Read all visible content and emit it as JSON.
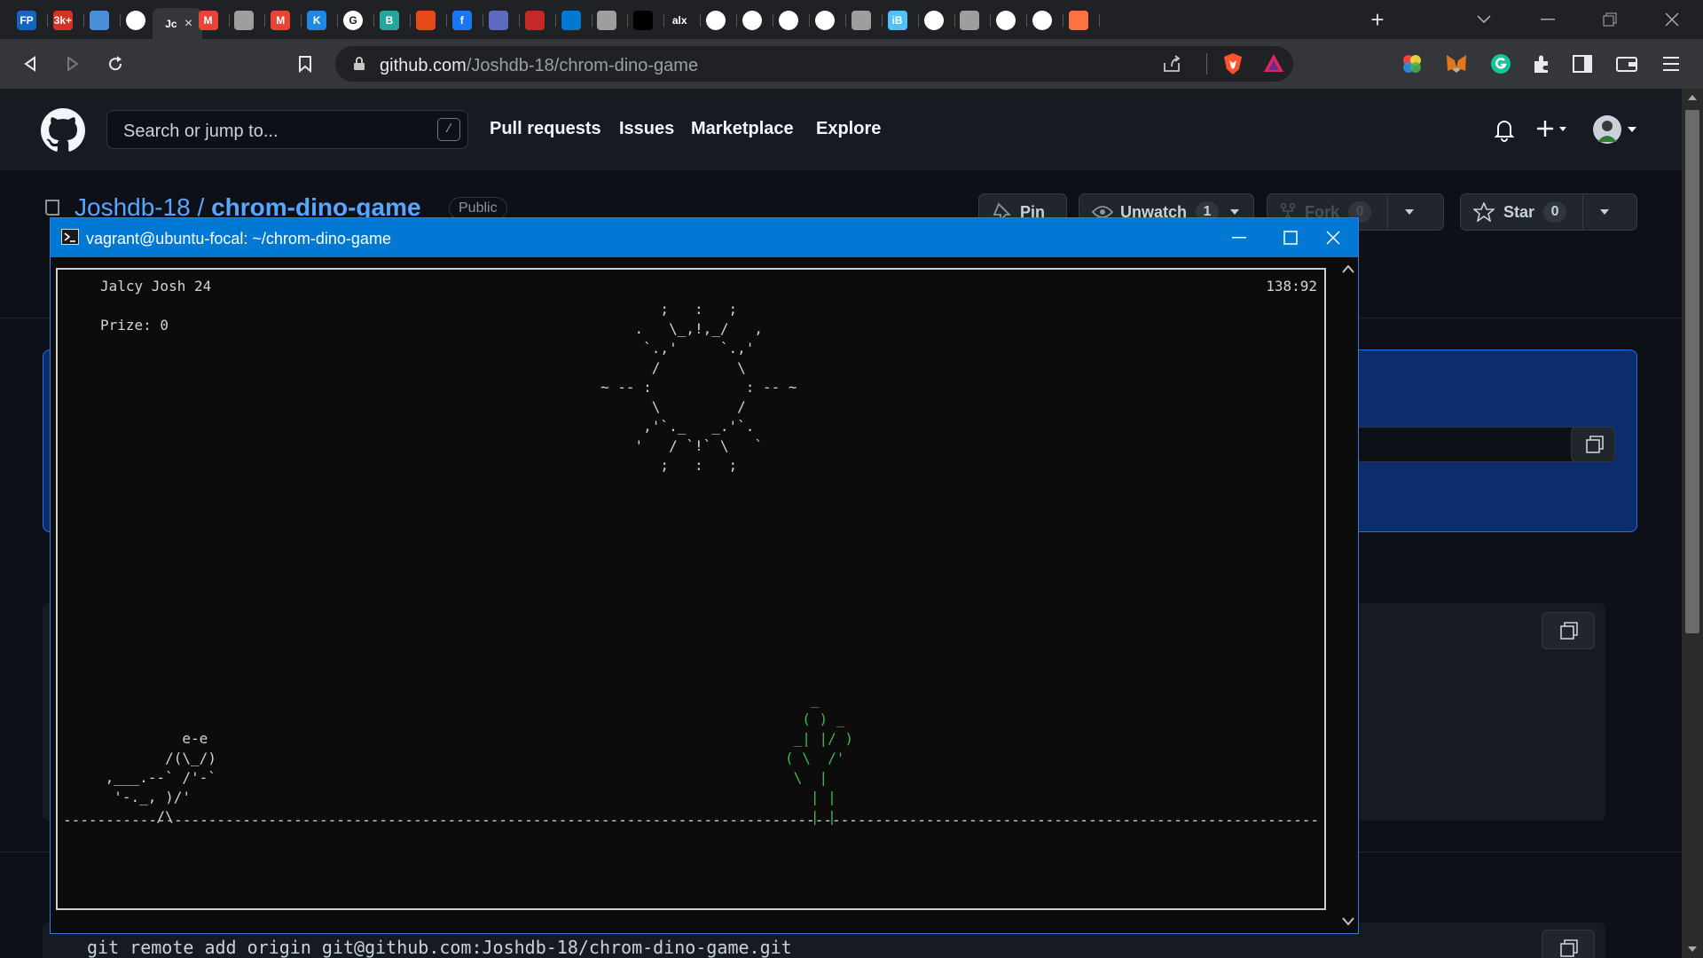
{
  "browser": {
    "tabs": [
      {
        "icon": "fp-icon",
        "label": "FP",
        "color": "#1565c0"
      },
      {
        "icon": "badge-icon",
        "label": "3k+",
        "color": "#d93025"
      },
      {
        "icon": "chat-icon",
        "label": "",
        "color": "#4a90d9"
      },
      {
        "icon": "github-icon",
        "label": "",
        "color": "#ffffff"
      },
      {
        "icon": "active-tab",
        "label": "Jc",
        "color": "#35363a"
      },
      {
        "icon": "gmail-icon",
        "label": "M",
        "color": "#ea4335"
      },
      {
        "icon": "page-icon",
        "label": "",
        "color": "#9e9e9e"
      },
      {
        "icon": "gmail-icon",
        "label": "M",
        "color": "#ea4335"
      },
      {
        "icon": "k-icon",
        "label": "K",
        "color": "#1e88e5"
      },
      {
        "icon": "google-icon",
        "label": "G",
        "color": "#ffffff"
      },
      {
        "icon": "b-icon",
        "label": "B",
        "color": "#26a69a"
      },
      {
        "icon": "x-icon",
        "label": "",
        "color": "#e64a19"
      },
      {
        "icon": "facebook-icon",
        "label": "f",
        "color": "#1877f2"
      },
      {
        "icon": "app-icon",
        "label": "",
        "color": "#5c6bc0"
      },
      {
        "icon": "gift-icon",
        "label": "",
        "color": "#c62828"
      },
      {
        "icon": "azure-icon",
        "label": "",
        "color": "#0078d4"
      },
      {
        "icon": "globe-icon",
        "label": "",
        "color": "#9e9e9e"
      },
      {
        "icon": "notion-icon",
        "label": "",
        "color": "#000000"
      },
      {
        "icon": "alx-icon",
        "label": "alx",
        "color": "#202124"
      },
      {
        "icon": "github-icon",
        "label": "",
        "color": "#ffffff"
      },
      {
        "icon": "circle-icon",
        "label": "",
        "color": "#ffffff"
      },
      {
        "icon": "github-icon",
        "label": "",
        "color": "#ffffff"
      },
      {
        "icon": "box-icon",
        "label": "",
        "color": "#ffffff"
      },
      {
        "icon": "globe-icon",
        "label": "",
        "color": "#9e9e9e"
      },
      {
        "icon": "ib-icon",
        "label": "iB",
        "color": "#4fc3f7"
      },
      {
        "icon": "github-icon",
        "label": "",
        "color": "#ffffff"
      },
      {
        "icon": "globe-icon",
        "label": "",
        "color": "#9e9e9e"
      },
      {
        "icon": "github-icon",
        "label": "",
        "color": "#ffffff"
      },
      {
        "icon": "github-icon",
        "label": "",
        "color": "#ffffff"
      },
      {
        "icon": "grid-icon",
        "label": "",
        "color": "#ff7043"
      }
    ],
    "new_tab": "+",
    "url_host": "github.com",
    "url_path": "/Joshdb-18/chrom-dino-game"
  },
  "github": {
    "search_placeholder": "Search or jump to...",
    "search_shortcut": "/",
    "nav": [
      "Pull requests",
      "Issues",
      "Marketplace",
      "Explore"
    ],
    "repo_owner": "Joshdb-18",
    "repo_sep": " / ",
    "repo_name": "chrom-dino-game",
    "visibility": "Public",
    "pin_label": "Pin",
    "unwatch_label": "Unwatch",
    "unwatch_count": "1",
    "fork_label": "Fork",
    "fork_count": "0",
    "star_label": "Star",
    "star_count": "0",
    "behind_command": "git remote add origin git@github.com:Joshdb-18/chrom-dino-game.git"
  },
  "terminal": {
    "title": "vagrant@ubuntu-focal: ~/chrom-dino-game",
    "player": "Jalcy Josh 24",
    "prize_label": "Prize: 0",
    "clock": "138:92",
    "sun_art": "       ;   :   ;\n    .   \\_,!,_/   ,\n     `.,'     `.,'\n      /         \\\n~ -- :           : -- ~\n      \\         /\n     ,'`._   _.'`.\n    '   / `!` \\   `\n       ;   :   ;",
    "dino_art": "          e-e\n        /(\\_/)\n ,___.--` /'-`\n  '-._, )/'\n       /\\",
    "cactus_art": "   _\n  ( ) _\n _| |/ )\n( \\  /'\n \\  |\n   | |\n   | |",
    "ground_char": "-",
    "ground_color": "#d4d4d4",
    "cactus_color": "#3fb950"
  }
}
